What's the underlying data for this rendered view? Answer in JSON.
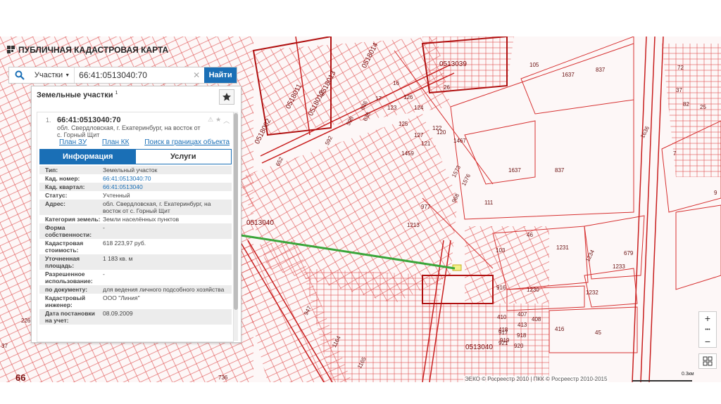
{
  "app": {
    "title": "ПУБЛИЧНАЯ КАДАСТРОВАЯ КАРТА"
  },
  "search": {
    "type_label": "Участки",
    "value": "66:41:0513040:70",
    "button_label": "Найти"
  },
  "panel": {
    "title": "Земельные участки",
    "count": "1"
  },
  "result": {
    "index": "1.",
    "cad_number": "66:41:0513040:70",
    "address": "обл. Свердловская, г. Екатеринбург, на восток от с. Горный Щит",
    "links": [
      "План ЗУ →",
      "План КК →",
      "Поиск в границах объекта →"
    ],
    "tabs": [
      "Информация",
      "Услуги"
    ],
    "rows": [
      {
        "k": "Тип:",
        "v": "Земельный участок"
      },
      {
        "k": "Кад. номер:",
        "v": "66:41:0513040:70"
      },
      {
        "k": "Кад. квартал:",
        "v": "66:41:0513040"
      },
      {
        "k": "Статус:",
        "v": "Учтенный"
      },
      {
        "k": "Адрес:",
        "v": "обл. Свердловская, г. Екатеринбург, на восток от с. Горный Щит"
      },
      {
        "k": "Категория земель:",
        "v": "Земли населённых пунктов"
      },
      {
        "k": "Форма собственности:",
        "v": "-"
      },
      {
        "k": "Кадастровая стоимость:",
        "v": "618 223,97 руб."
      },
      {
        "k": "Уточненная площадь:",
        "v": "1 183 кв. м"
      },
      {
        "k": "Разрешенное использование:",
        "v": "-"
      },
      {
        "k": "по документу:",
        "v": "для ведения личного подсобного хозяйства"
      },
      {
        "k": "Кадастровый инженер:",
        "v": "ООО \"Линия\""
      },
      {
        "k": "Дата постановки на учет:",
        "v": "08.09.2009"
      }
    ]
  },
  "map": {
    "labels": [
      "0518014",
      "0513039",
      "0518013",
      "0518012",
      "0518011",
      "0518002",
      "0513040",
      "0513040",
      "1637",
      "837",
      "1637",
      "837",
      "105",
      "72",
      "1467",
      "1459",
      "977",
      "1213",
      "1231",
      "1233",
      "1232",
      "1230",
      "46",
      "45",
      "103",
      "111",
      "916",
      "410",
      "407",
      "408",
      "413",
      "416",
      "418",
      "917",
      "918",
      "919",
      "920",
      "921",
      "1164",
      "1165",
      "947",
      "736",
      "226",
      "37",
      "26",
      "17",
      "16",
      "126",
      "123",
      "124",
      "125",
      "127",
      "121",
      "122",
      "120",
      "598",
      "638",
      "636",
      "592",
      "652",
      "1573",
      "1576",
      "968",
      "679",
      "1234",
      "1636",
      "7",
      "9",
      "82",
      "25",
      "37",
      "66"
    ],
    "scale_label": "0.3км",
    "copyright": "ЭЕКО © Росреестр 2010 | ПКК © Росреестр 2010-2015",
    "zoom_in": "+",
    "zoom_dots": "•••",
    "zoom_out": "−"
  }
}
